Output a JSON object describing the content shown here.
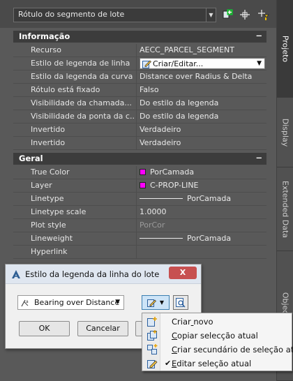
{
  "toolbar": {
    "selector_value": "Rótulo do segmento de lote"
  },
  "sections": {
    "info": {
      "title": "Informação",
      "collapse": "−"
    },
    "general": {
      "title": "Geral",
      "collapse": "−"
    }
  },
  "info_rows": [
    {
      "key": "Recurso",
      "value": "AECC_PARCEL_SEGMENT"
    },
    {
      "key": "Estilo de legenda de linha",
      "value": "Criar/Editar..."
    },
    {
      "key": "Estilo da legenda da curva",
      "value": "Distance over Radius & Delta"
    },
    {
      "key": "Rótulo está fixado",
      "value": "Falso"
    },
    {
      "key": "Visibilidade da chamada...",
      "value": "Do estilo da legenda"
    },
    {
      "key": "Visibilidade da ponta da c...",
      "value": "Do estilo da legenda"
    },
    {
      "key": "Invertido",
      "value": "Verdadeiro"
    },
    {
      "key": "Invertido",
      "value": "Verdadeiro"
    }
  ],
  "general_rows": [
    {
      "key": "True Color",
      "value": "PorCamada"
    },
    {
      "key": "Layer",
      "value": "C-PROP-LINE"
    },
    {
      "key": "Linetype",
      "value": "PorCamada"
    },
    {
      "key": "Linetype scale",
      "value": "1.0000"
    },
    {
      "key": "Plot style",
      "value": "PorCor"
    },
    {
      "key": "Lineweight",
      "value": "PorCamada"
    },
    {
      "key": "Hyperlink",
      "value": ""
    }
  ],
  "tabs": [
    "Projeto",
    "Display",
    "Extended Data",
    "Object Class"
  ],
  "dialog": {
    "title": "Estilo da legenda da linha do lote",
    "close": "X",
    "style_value": "Bearing over Distance",
    "ok": "OK",
    "cancel": "Cancelar"
  },
  "menu": {
    "items": [
      {
        "label": "Criar novo",
        "checked": false
      },
      {
        "label": "Copiar selecção atual",
        "checked": false
      },
      {
        "label": "Criar secundário de seleção atual",
        "checked": false
      },
      {
        "label": "Editar seleção atual",
        "checked": true
      }
    ],
    "check_glyph": "✔"
  },
  "colors": {
    "swatch": "#ff00ff",
    "panel": "#595959",
    "dialog": "#f0f0f0",
    "close": "#c75050"
  }
}
